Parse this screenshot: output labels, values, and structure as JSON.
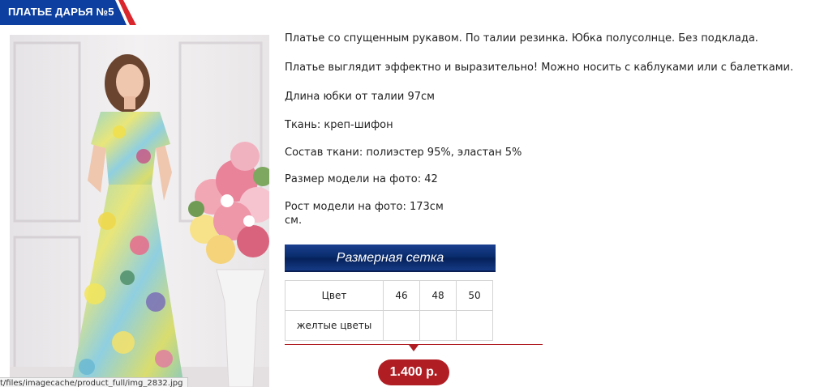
{
  "product": {
    "title": "ПЛАТЬЕ ДАРЬЯ №5",
    "photo_alt": "dress-photo"
  },
  "description": {
    "lines": [
      "Платье со спущенным рукавом. По талии резинка. Юбка полусолнце. Без подклада.",
      "Платье выглядит эффектно и выразительно! Можно носить с каблуками или с балетками.",
      "Длина юбки от талии 97см",
      "Ткань: креп-шифон",
      "Состав ткани: полиэстер 95%, эластан 5%",
      "Размер модели на фото: 42",
      "Рост модели на фото: 173см",
      "см."
    ]
  },
  "size_grid": {
    "title": "Размерная сетка",
    "header": [
      "Цвет",
      "46",
      "48",
      "50"
    ],
    "rows": [
      [
        "желтые цветы",
        "",
        "",
        ""
      ]
    ]
  },
  "price": {
    "value": "1.400 р."
  },
  "status_bar": {
    "url": "t/files/imagecache/product_full/img_2832.jpg"
  },
  "colors": {
    "title_tab_blue": "#0c3fa0",
    "title_tab_red": "#d9262c",
    "size_header_blue": "#0a2d6e",
    "price_red": "#b01e24"
  }
}
